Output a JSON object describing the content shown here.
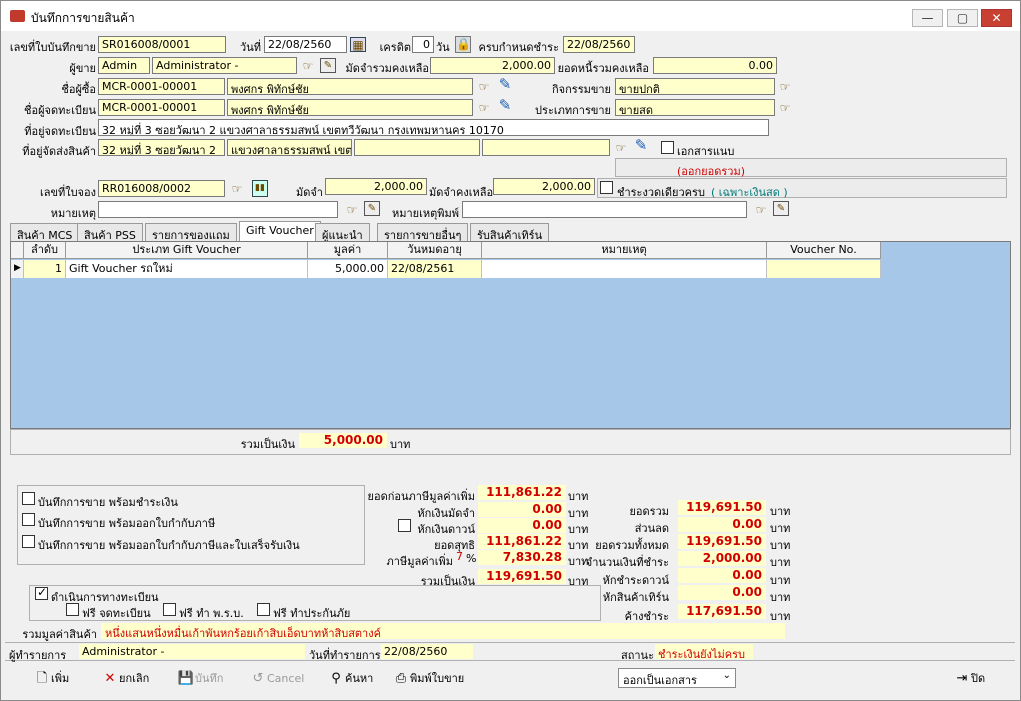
{
  "window": {
    "title": "บันทึกการขายสินค้า",
    "minimize": "—",
    "maximize": "▢",
    "close": "✕"
  },
  "header": {
    "doc_no_label": "เลขที่ใบบันทึกขาย",
    "doc_no": "SR016008/0001",
    "date_label": "วันที่",
    "date": "22/08/2560",
    "credit_label": "เครดิต",
    "credit": "0",
    "credit_unit": "วัน",
    "due_label": "ครบกำหนดชำระ",
    "due": "22/08/2560",
    "seller_label": "ผู้ขาย",
    "seller_code": "Admin",
    "seller_name": "Administrator -",
    "deposit_balance_label": "มัดจำรวมคงเหลือ",
    "deposit_balance": "2,000.00",
    "debt_balance_label": "ยอดหนี้รวมคงเหลือ",
    "debt_balance": "0.00",
    "buyer_label": "ชื่อผู้ซื้อ",
    "buyer_code": "MCR-0001-00001",
    "buyer_name": "พงศกร พิทักษ์ชัย",
    "activity_label": "กิจกรรมขาย",
    "activity": "ขายปกติ",
    "registrant_label": "ชื่อผู้จดทะเบียน",
    "registrant_code": "MCR-0001-00001",
    "registrant_name": "พงศกร พิทักษ์ชัย",
    "sale_type_label": "ประเภทการขาย",
    "sale_type": "ขายสด",
    "reg_address_label": "ที่อยู่จดทะเบียน",
    "reg_address": "32 หมู่ที่ 3 ซอยวัฒนา 2 แขวงศาลาธรรมสพน์ เขตทวีวัฒนา กรุงเทพมหานคร 10170",
    "ship_address_label": "ที่อยู่จัดส่งสินค้า",
    "ship_address_1": "32 หมู่ที่ 3 ซอยวัฒนา 2",
    "ship_address_2": "แขวงศาลาธรรมสพน์ เขต",
    "attach_label": "เอกสารแนบ",
    "cancel_notice": "(ออกยอดรวม)",
    "booking_label": "เลขที่ใบจอง",
    "booking_no": "RR016008/0002",
    "deposit_label": "มัดจำ",
    "deposit": "2,000.00",
    "deposit_remain_label": "มัดจำคงเหลือ",
    "deposit_remain": "2,000.00",
    "single_pay_label": "ชำระงวดเดียวครบ",
    "cash_only_label": "( เฉพาะเงินสด )",
    "note_label": "หมายเหตุ",
    "print_note_label": "หมายเหตุพิมพ์"
  },
  "tabs": [
    {
      "label": "สินค้า MCS"
    },
    {
      "label": "สินค้า PSS"
    },
    {
      "label": "รายการของแถม"
    },
    {
      "label": "Gift Voucher"
    },
    {
      "label": "ผู้แนะนำ"
    },
    {
      "label": "รายการขายอื่นๆ"
    },
    {
      "label": "รับสินค้าเทิร์น"
    }
  ],
  "grid": {
    "columns": [
      "ลำดับ",
      "ประเภท Gift Voucher",
      "มูลค่า",
      "วันหมดอายุ",
      "หมายเหตุ",
      "Voucher No."
    ],
    "rows": [
      {
        "seq": "1",
        "type": "Gift Voucher รถใหม่",
        "value": "5,000.00",
        "expire": "22/08/2561",
        "note": "",
        "voucher": ""
      }
    ],
    "total_label": "รวมเป็นเงิน",
    "total": "5,000.00",
    "total_unit": "บาท"
  },
  "options": {
    "opt1": "บันทึกการขาย พร้อมชำระเงิน",
    "opt2": "บันทึกการขาย พร้อมออกใบกำกับภาษี",
    "opt3": "บันทึกการขาย พร้อมออกใบกำกับภาษีและใบเสร็จรับเงิน",
    "registration_label": "ดำเนินการทางทะเบียน",
    "free_reg": "ฟรี จดทะเบียน",
    "free_act": "ฟรี ทำ พ.ร.บ.",
    "free_insurance": "ฟรี ทำประกันภัย",
    "total_text_label": "รวมมูลค่าสินค้า",
    "total_text": "หนึ่งแสนหนึ่งหมื่นเก้าพันหกร้อยเก้าสิบเอ็ดบาทห้าสิบสตางค์"
  },
  "summary": {
    "unit": "บาท",
    "before_vat_label": "ยอดก่อนภาษีมูลค่าเพิ่ม",
    "before_vat": "111,861.22",
    "less_deposit_label": "หักเงินมัดจำ",
    "less_deposit": "0.00",
    "less_down_label": "หักเงินดาวน์",
    "less_down": "0.00",
    "net_label": "ยอดสุทธิ",
    "net": "111,861.22",
    "vat_label": "ภาษีมูลค่าเพิ่ม",
    "vat_rate": "7",
    "vat_pct": "%",
    "vat": "7,830.28",
    "grand_label": "รวมเป็นเงิน",
    "grand": "119,691.50",
    "total_label": "ยอดรวม",
    "total": "119,691.50",
    "discount_label": "ส่วนลด",
    "discount": "0.00",
    "all_total_label": "ยอดรวมทั้งหมด",
    "all_total": "119,691.50",
    "to_pay_label": "จำนวนเงินที่ชำระ",
    "to_pay": "2,000.00",
    "less_down_pay_label": "หักชำระดาวน์",
    "less_down_pay": "0.00",
    "less_trade_label": "หักสินค้าเทิร์น",
    "less_trade": "0.00",
    "outstanding_label": "ค้างชำระ",
    "outstanding": "117,691.50"
  },
  "status": {
    "maker_label": "ผู้ทำรายการ",
    "maker": "Administrator -",
    "made_date_label": "วันที่ทำรายการ",
    "made_date": "22/08/2560",
    "state_label": "สถานะ",
    "state": "ชำระเงินยังไม่ครบ"
  },
  "toolbar": {
    "add": "เพิ่ม",
    "cancel_doc": "ยกเลิก",
    "save": "บันทึก",
    "cancel": "Cancel",
    "search": "ค้นหา",
    "print": "พิมพ์ใบขาย",
    "issue_select": "ออกเป็นเอกสาร",
    "close": "ปิด"
  }
}
